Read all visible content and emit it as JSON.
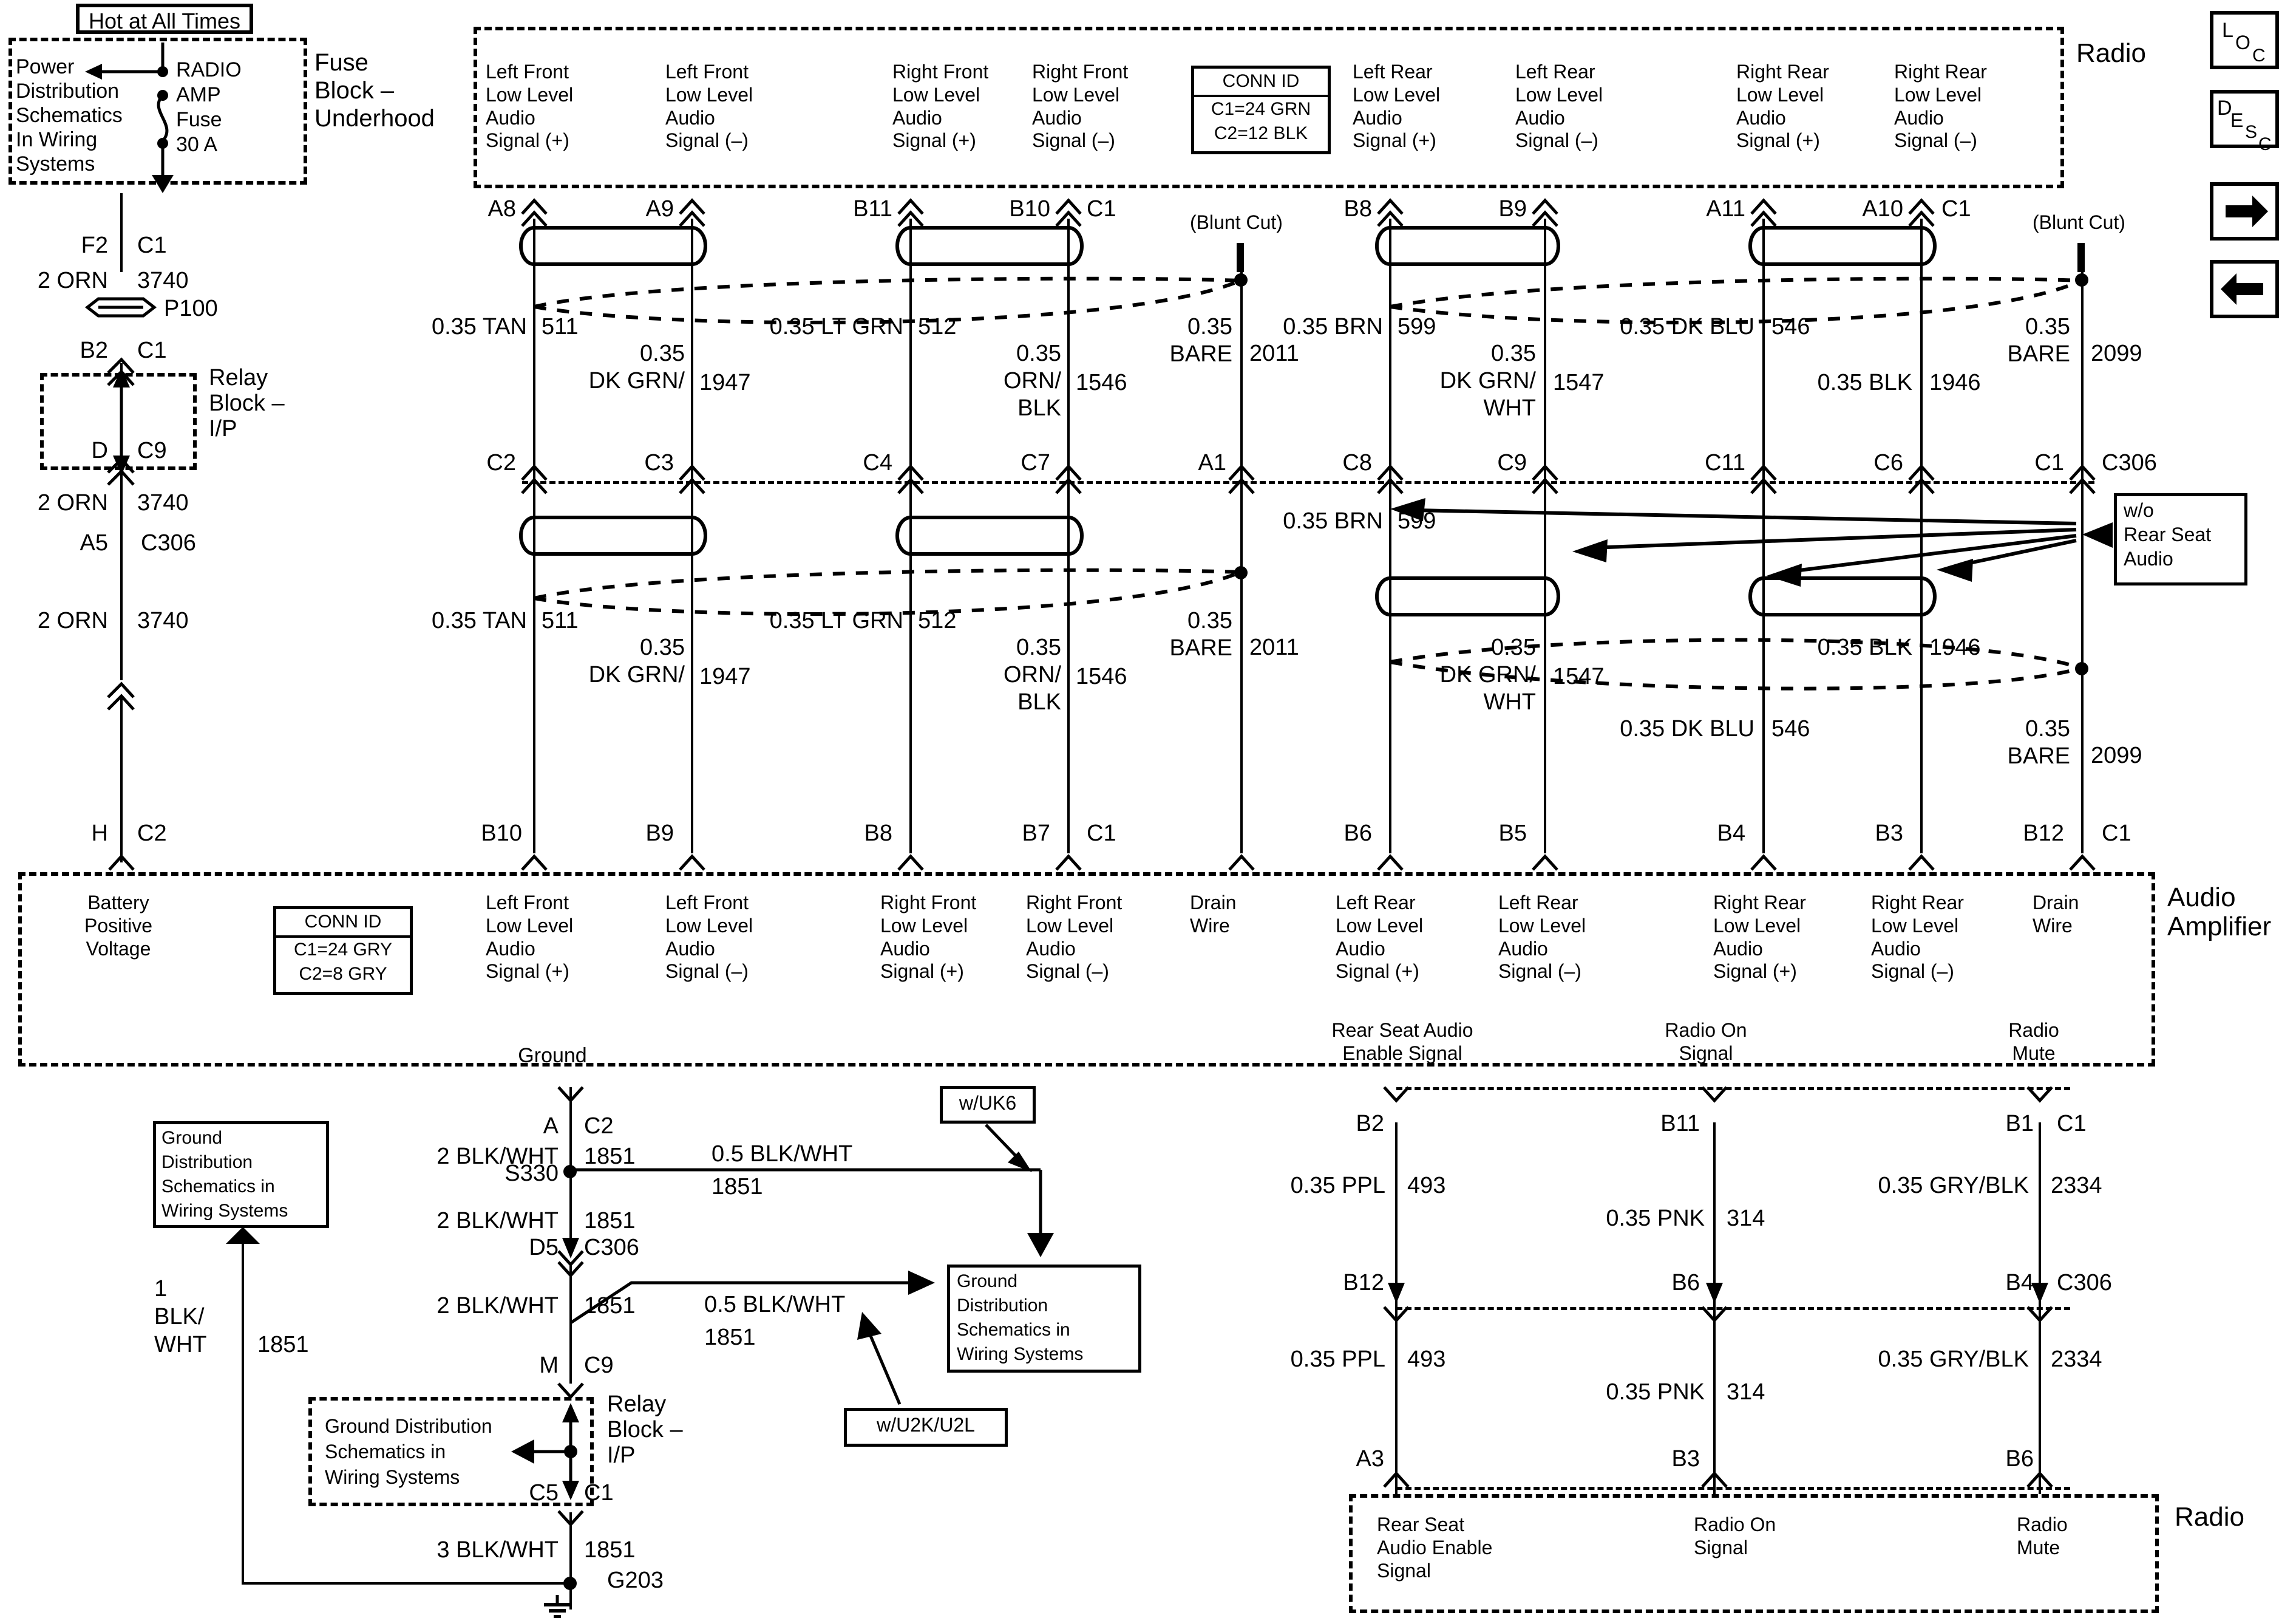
{
  "diagram": {
    "title_top_left": "Hot at All Times",
    "corner_icons": {
      "loc": "LOC",
      "desc": "DESC"
    },
    "module_labels": {
      "fuse_block": "Fuse\nBlock –\nUnderhood",
      "radio_top": "Radio",
      "relay_block_1": "Relay\nBlock –\nI/P",
      "relay_block_2": "Relay\nBlock –\nI/P",
      "audio_amplifier": "Audio\nAmplifier",
      "radio_bottom": "Radio"
    },
    "fuse": {
      "ref_box_text": "Power\nDistribution\nSchematics\nIn Wiring\nSystems",
      "fuse_name": "RADIO\nAMP\nFuse\n30 A"
    },
    "power_path": [
      {
        "left_term": "F2",
        "right_term": "C1",
        "wire": "2 ORN",
        "circuit": "3740"
      },
      {
        "connector": "P100"
      },
      {
        "left_term": "B2",
        "right_term": "C1"
      },
      {
        "left_term": "D",
        "right_term": "C9",
        "wire": "2 ORN",
        "circuit": "3740"
      },
      {
        "left_term": "A5",
        "right_term": "C306",
        "wire": "2 ORN",
        "circuit": "3740"
      },
      {
        "left_term": "H",
        "right_term": "C2"
      }
    ],
    "conn_id_radio": {
      "header": "CONN ID",
      "lines": [
        "C1=24 GRN",
        "C2=12 BLK"
      ]
    },
    "conn_id_amp": {
      "header": "CONN ID",
      "lines": [
        "C1=24 GRY",
        "C2=8 GRY"
      ]
    },
    "blunt_cut": "(Blunt Cut)",
    "wo_rear_seat_audio": "w/o\nRear Seat\nAudio",
    "radio_top_signals": [
      {
        "label": "Left Front\nLow Level\nAudio\nSignal (+)",
        "pin": "A8"
      },
      {
        "label": "Left Front\nLow Level\nAudio\nSignal (–)",
        "pin": "A9"
      },
      {
        "label": "Right Front\nLow Level\nAudio\nSignal (+)",
        "pin": "B11"
      },
      {
        "label": "Right Front\nLow Level\nAudio\nSignal (–)",
        "pin": "B10"
      },
      {
        "label": "",
        "pin": "C1"
      },
      {
        "label": "Left Rear\nLow Level\nAudio\nSignal (+)",
        "pin": "B8"
      },
      {
        "label": "Left Rear\nLow Level\nAudio\nSignal (–)",
        "pin": "B9"
      },
      {
        "label": "Right Rear\nLow Level\nAudio\nSignal (+)",
        "pin": "A11"
      },
      {
        "label": "Right Rear\nLow Level\nAudio\nSignal (–)",
        "pin": "A10"
      },
      {
        "label": "",
        "pin": "C1"
      }
    ],
    "mid_row_upper_pins": [
      "C2",
      "C3",
      "C4",
      "C7",
      "A1",
      "C8",
      "C9",
      "C11",
      "C6",
      "C1",
      "C306"
    ],
    "mid_row_lower_pins": [
      "B10",
      "B9",
      "B8",
      "B7",
      "C1",
      "B6",
      "B5",
      "B4",
      "B3",
      "B12",
      "C1"
    ],
    "wire_labels_upper": [
      {
        "color": "0.35 TAN",
        "circuit": "511"
      },
      {
        "color": "0.35\nDK GRN/",
        "circuit": "1947"
      },
      {
        "color": "0.35 LT GRN",
        "circuit": "512"
      },
      {
        "color": "0.35\nORN/\nBLK",
        "circuit": "1546"
      },
      {
        "color": "0.35\nBARE",
        "circuit": "2011"
      },
      {
        "color": "0.35 BRN",
        "circuit": "599"
      },
      {
        "color": "0.35\nDK GRN/\nWHT",
        "circuit": "1547"
      },
      {
        "color": "0.35 DK BLU",
        "circuit": "546"
      },
      {
        "color": "0.35 BLK",
        "circuit": "1946"
      },
      {
        "color": "0.35\nBARE",
        "circuit": "2099"
      }
    ],
    "wire_labels_lower": [
      {
        "color": "0.35 TAN",
        "circuit": "511"
      },
      {
        "color": "0.35\nDK GRN/",
        "circuit": "1947"
      },
      {
        "color": "0.35 LT GRN",
        "circuit": "512"
      },
      {
        "color": "0.35\nORN/\nBLK",
        "circuit": "1546"
      },
      {
        "color": "0.35\nBARE",
        "circuit": "2011"
      },
      {
        "color": "0.35 BRN",
        "circuit": "599"
      },
      {
        "color": "0.35\nDK GRN/\nWHT",
        "circuit": "1547"
      },
      {
        "color": "0.35 DK BLU",
        "circuit": "546"
      },
      {
        "color": "0.35 BLK",
        "circuit": "1946"
      },
      {
        "color": "0.35\nBARE",
        "circuit": "2099"
      }
    ],
    "amp_signals": [
      "Battery\nPositive\nVoltage",
      "Left Front\nLow Level\nAudio\nSignal (+)",
      "Left Front\nLow Level\nAudio\nSignal (–)",
      "Right Front\nLow Level\nAudio\nSignal (+)",
      "Right Front\nLow Level\nAudio\nSignal (–)",
      "Drain\nWire",
      "Left Rear\nLow Level\nAudio\nSignal (+)",
      "Left Rear\nLow Level\nAudio\nSignal (–)",
      "Right Rear\nLow Level\nAudio\nSignal (+)",
      "Right Rear\nLow Level\nAudio\nSignal (–)",
      "Drain\nWire"
    ],
    "amp_control_signals": [
      "Rear Seat Audio\nEnable Signal",
      "Radio On\nSignal",
      "Radio\nMute"
    ],
    "ground": {
      "header": "Ground",
      "s330": "S330",
      "g203": "G203",
      "ref_box_1": "Ground\nDistribution\nSchematics in\nWiring Systems",
      "ref_box_2": "Ground\nDistribution\nSchematics in\nWiring Systems",
      "ref_box_3": "Ground Distribution\nSchematics in\nWiring Systems",
      "opt_uk6": "w/UK6",
      "opt_u2k_u2l": "w/U2K/U2L",
      "segments": [
        {
          "left_term": "A",
          "right_term": "C2",
          "wire": "2 BLK/WHT",
          "circuit": "1851"
        },
        {
          "left_term": "",
          "right_term": "",
          "wire": "2 BLK/WHT",
          "circuit": "1851"
        },
        {
          "left_term": "D5",
          "right_term": "C306",
          "wire": "2 BLK/WHT",
          "circuit": "1851"
        },
        {
          "left_term": "M",
          "right_term": "C9",
          "wire": "2 BLK/WHT",
          "circuit": "1851"
        },
        {
          "left_term": "C5",
          "right_term": "C1",
          "wire": "3 BLK/WHT",
          "circuit": "1851"
        }
      ],
      "branch_upper": {
        "wire": "0.5 BLK/WHT",
        "circuit": "1851"
      },
      "branch_lower": {
        "wire": "0.5 BLK/WHT",
        "circuit": "1851"
      },
      "left_feed": {
        "wire": "1\nBLK/\nWHT",
        "circuit": "1851"
      }
    },
    "radio_bottom_rows": {
      "top_pins": [
        "B2",
        "B11",
        "B1",
        "C1"
      ],
      "mid_pins": [
        "B12",
        "B6",
        "B4",
        "C306"
      ],
      "bot_pins": [
        "A3",
        "B3",
        "B6"
      ],
      "upper_wires": [
        {
          "color": "0.35 PPL",
          "circuit": "493"
        },
        {
          "color": "0.35 PNK",
          "circuit": "314"
        },
        {
          "color": "0.35 GRY/BLK",
          "circuit": "2334"
        }
      ],
      "lower_wires": [
        {
          "color": "0.35 PPL",
          "circuit": "493"
        },
        {
          "color": "0.35 PNK",
          "circuit": "314"
        },
        {
          "color": "0.35 GRY/BLK",
          "circuit": "2334"
        }
      ],
      "signal_labels": [
        "Rear Seat\nAudio Enable\nSignal",
        "Radio On\nSignal",
        "Radio\nMute"
      ]
    }
  }
}
